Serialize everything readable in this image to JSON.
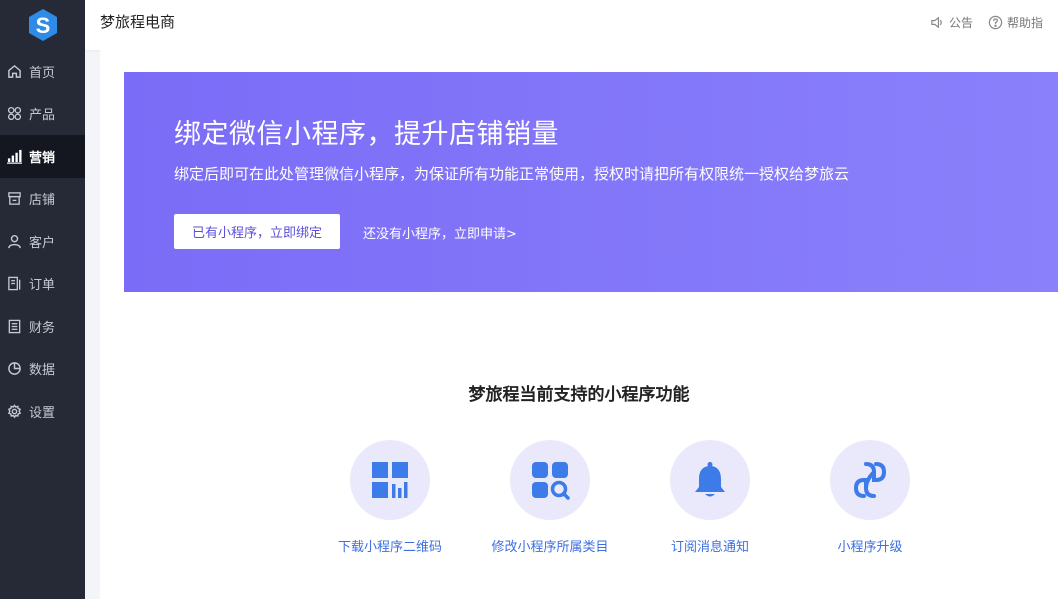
{
  "app": {
    "title": "梦旅程电商"
  },
  "header": {
    "announce": "公告",
    "help": "帮助指"
  },
  "sidebar": {
    "items": [
      {
        "label": "首页",
        "icon": "home-icon"
      },
      {
        "label": "产品",
        "icon": "product-icon"
      },
      {
        "label": "营销",
        "icon": "marketing-icon",
        "active": true
      },
      {
        "label": "店铺",
        "icon": "store-icon"
      },
      {
        "label": "客户",
        "icon": "customer-icon"
      },
      {
        "label": "订单",
        "icon": "order-icon"
      },
      {
        "label": "财务",
        "icon": "finance-icon"
      },
      {
        "label": "数据",
        "icon": "data-icon"
      },
      {
        "label": "设置",
        "icon": "settings-icon"
      }
    ]
  },
  "banner": {
    "title": "绑定微信小程序，提升店铺销量",
    "description": "绑定后即可在此处管理微信小程序，为保证所有功能正常使用，授权时请把所有权限统一授权给梦旅云",
    "bind_button": "已有小程序，立即绑定",
    "apply_link": "还没有小程序，立即申请>"
  },
  "features": {
    "title": "梦旅程当前支持的小程序功能",
    "items": [
      {
        "label": "下载小程序二维码",
        "icon": "qrcode-icon"
      },
      {
        "label": "修改小程序所属类目",
        "icon": "category-search-icon"
      },
      {
        "label": "订阅消息通知",
        "icon": "bell-icon"
      },
      {
        "label": "小程序升级",
        "icon": "link-icon"
      }
    ]
  },
  "colors": {
    "sidebar_bg": "#262a36",
    "banner": "#7b6cf7",
    "accent": "#3d6fe0",
    "icon_bg": "#eae8fb"
  }
}
